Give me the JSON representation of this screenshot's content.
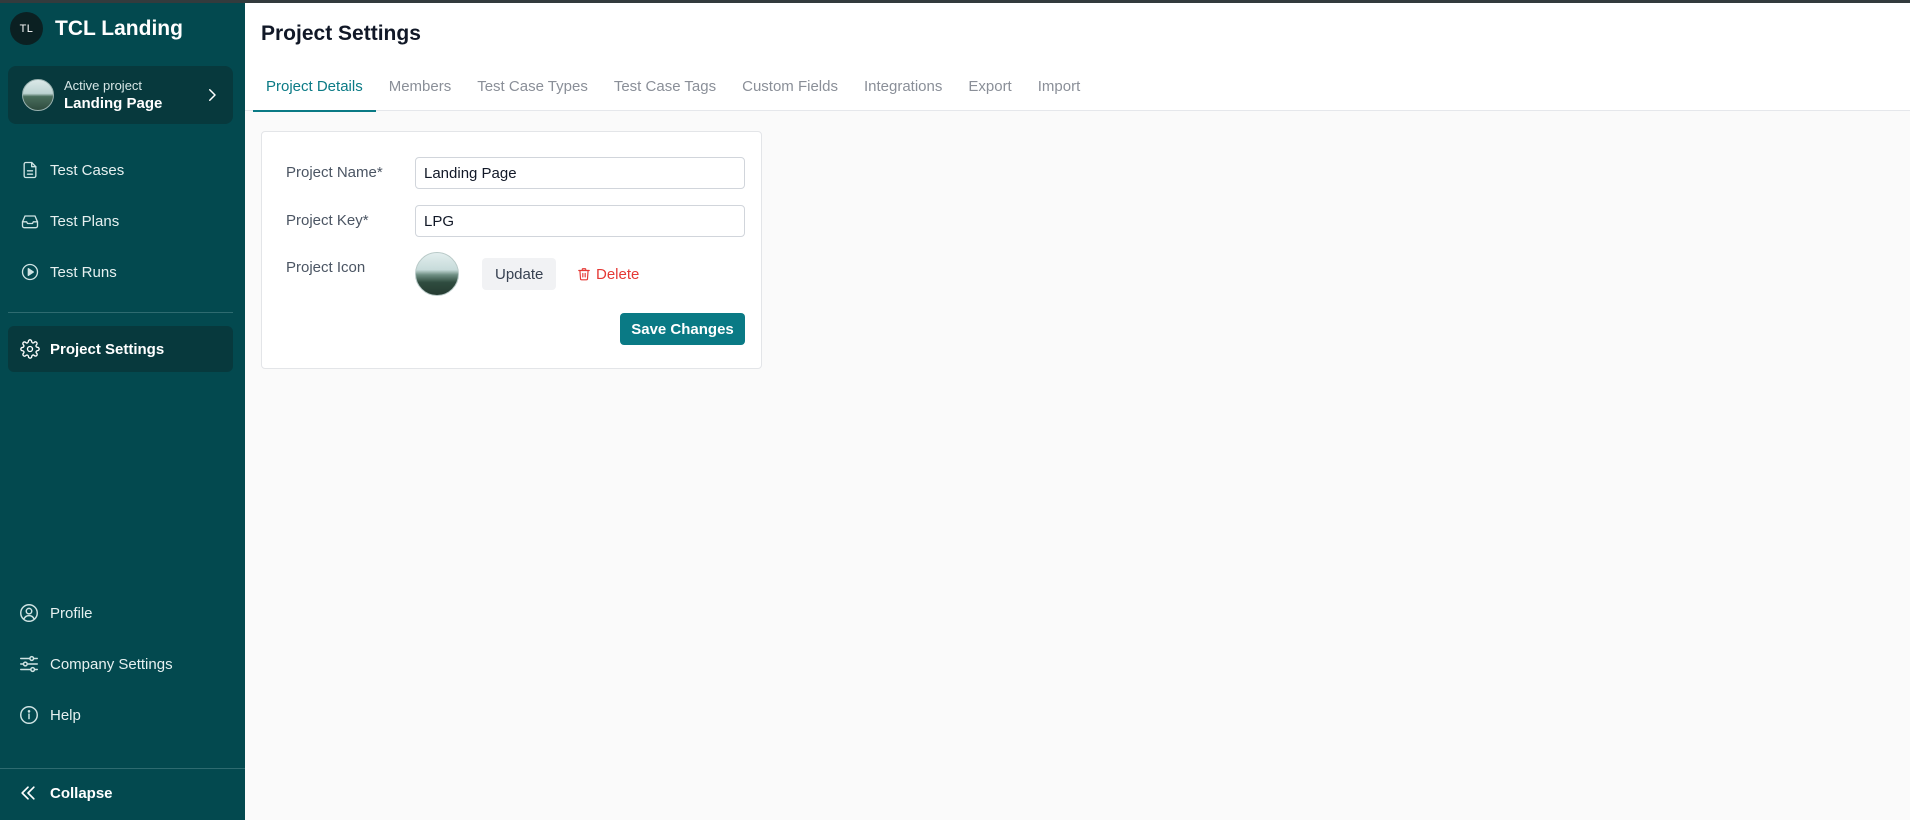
{
  "brand": {
    "logo_text": "TL",
    "name": "TCL Landing"
  },
  "active_project": {
    "caption": "Active project",
    "name": "Landing Page"
  },
  "sidebar": {
    "nav": [
      {
        "label": "Test Cases",
        "icon": "document-icon"
      },
      {
        "label": "Test Plans",
        "icon": "inbox-icon"
      },
      {
        "label": "Test Runs",
        "icon": "play-circle-icon"
      }
    ],
    "settings_item": {
      "label": "Project Settings",
      "icon": "gear-icon"
    },
    "bottom": [
      {
        "label": "Profile",
        "icon": "user-circle-icon"
      },
      {
        "label": "Company Settings",
        "icon": "sliders-icon"
      },
      {
        "label": "Help",
        "icon": "info-icon"
      }
    ],
    "collapse_label": "Collapse"
  },
  "header": {
    "title": "Project Settings",
    "tabs": [
      "Project Details",
      "Members",
      "Test Case Types",
      "Test Case Tags",
      "Custom Fields",
      "Integrations",
      "Export",
      "Import"
    ],
    "active_tab": "Project Details"
  },
  "form": {
    "name_label": "Project Name*",
    "name_value": "Landing Page",
    "key_label": "Project Key*",
    "key_value": "LPG",
    "icon_label": "Project Icon",
    "update_label": "Update",
    "delete_label": "Delete",
    "save_label": "Save Changes"
  },
  "colors": {
    "sidebar_bg": "#03494f",
    "sidebar_active": "#07393d",
    "accent": "#0a7a85",
    "danger": "#e53935"
  }
}
